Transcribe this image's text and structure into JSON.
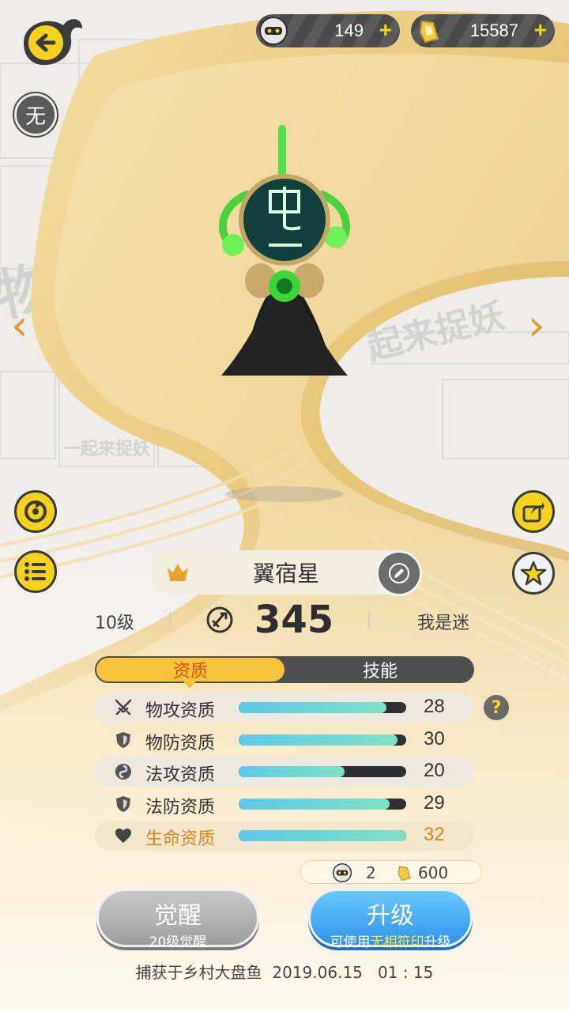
{
  "header": {
    "currency_1": {
      "icon": "mask-coin-icon",
      "amount": "149",
      "plus": "+"
    },
    "currency_2": {
      "icon": "gold-ingot-icon",
      "amount": "15587",
      "plus": "+"
    },
    "back_icon": "back-arrow-icon",
    "no_label": "无"
  },
  "navigation": {
    "prev": "‹",
    "next": "›"
  },
  "side_buttons": {
    "left": [
      "recycle-icon",
      "list-icon"
    ],
    "right": [
      "share-icon",
      "star-icon"
    ]
  },
  "monster": {
    "name": "翼宿星",
    "level": "10级",
    "power": "345",
    "owner": "我是迷"
  },
  "tabs": [
    {
      "label": "资质",
      "active": true
    },
    {
      "label": "技能",
      "active": false
    }
  ],
  "stats": [
    {
      "label": "物攻资质",
      "value": "28",
      "fill": 0.88,
      "icon": "swords-icon"
    },
    {
      "label": "物防资质",
      "value": "30",
      "fill": 0.95,
      "icon": "shield-icon"
    },
    {
      "label": "法攻资质",
      "value": "20",
      "fill": 0.63,
      "icon": "swirl-icon"
    },
    {
      "label": "法防资质",
      "value": "29",
      "fill": 0.9,
      "icon": "shield-icon"
    },
    {
      "label": "生命资质",
      "value": "32",
      "fill": 1.0,
      "icon": "heart-icon"
    }
  ],
  "help": "?",
  "cost": {
    "mask_count": "2",
    "gold_count": "600"
  },
  "buttons": {
    "awaken": {
      "title": "觉醒",
      "sub": "20级觉醒"
    },
    "upgrade": {
      "title": "升级",
      "sub_pre": "可使用",
      "sub_hl": "无相符印",
      "sub_post": "升级"
    }
  },
  "footer": "捕获于乡村大盘鱼  2019.06.15   01 : 15",
  "colors": {
    "accent_yellow": "#f4d21e",
    "orange": "#d9861c",
    "blue": "#2f93e8"
  }
}
